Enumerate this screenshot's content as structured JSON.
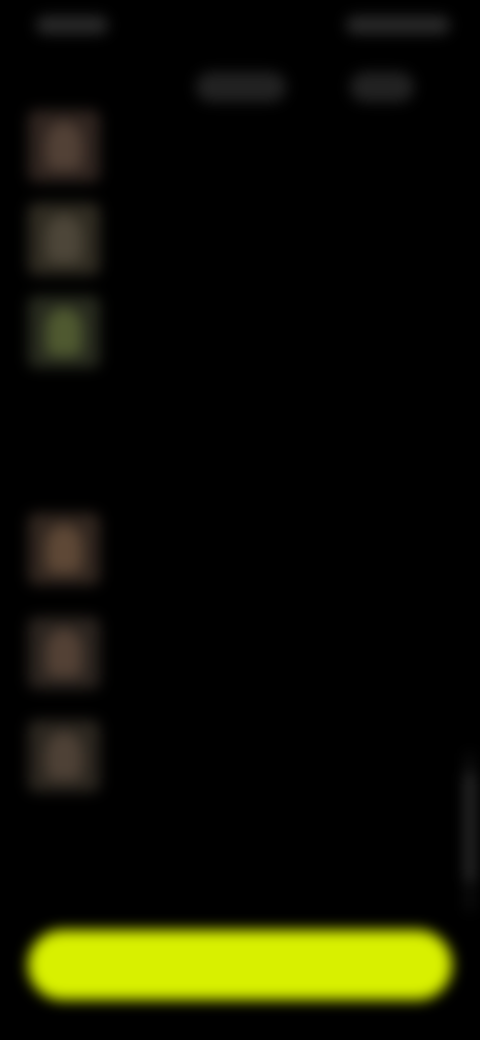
{
  "status_bar": {
    "time": "",
    "icons": [
      "signal-icon",
      "wifi-icon",
      "battery-icon"
    ]
  },
  "header": {
    "controls": [
      "",
      ""
    ]
  },
  "items_top": [
    {
      "title": "",
      "subtitle": "",
      "thumb_icon": "cover-image"
    },
    {
      "title": "",
      "subtitle": "",
      "thumb_icon": "cover-image"
    },
    {
      "title": "",
      "subtitle": "",
      "thumb_icon": "cover-image"
    }
  ],
  "section": {
    "title": ""
  },
  "items_bottom": [
    {
      "title": "",
      "subtitle": "",
      "thumb_icon": "cover-image"
    },
    {
      "title": "",
      "subtitle": "",
      "thumb_icon": "cover-image"
    },
    {
      "title": "",
      "subtitle": "",
      "thumb_icon": "cover-image"
    }
  ],
  "primary_action": {
    "label": ""
  },
  "colors": {
    "background": "#000000",
    "accent": "#d8f000",
    "text": "#f0f0f0"
  }
}
